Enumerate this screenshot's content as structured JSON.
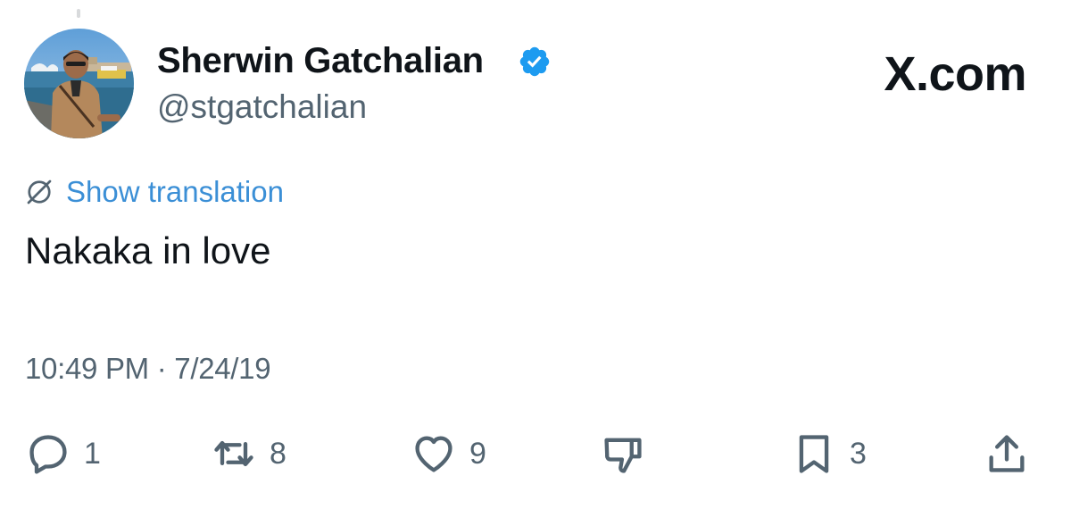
{
  "author": {
    "display_name": "Sherwin Gatchalian",
    "handle": "@stgatchalian",
    "verified_color": "#1d9bf0"
  },
  "brand": {
    "label": "X.com"
  },
  "translation": {
    "label": "Show translation",
    "icon": "globe-slash-icon"
  },
  "tweet": {
    "text": "Nakaka in love",
    "timestamp": "10:49 PM · 7/24/19"
  },
  "actions": {
    "reply": {
      "icon": "reply-icon",
      "count": "1"
    },
    "retweet": {
      "icon": "retweet-icon",
      "count": "8"
    },
    "like": {
      "icon": "heart-icon",
      "count": "9"
    },
    "dislike": {
      "icon": "thumbs-down-icon"
    },
    "bookmark": {
      "icon": "bookmark-icon",
      "count": "3"
    },
    "share": {
      "icon": "share-icon"
    }
  },
  "colors": {
    "text": "#0f1419",
    "secondary": "#536471",
    "link": "#3b8fd6"
  }
}
